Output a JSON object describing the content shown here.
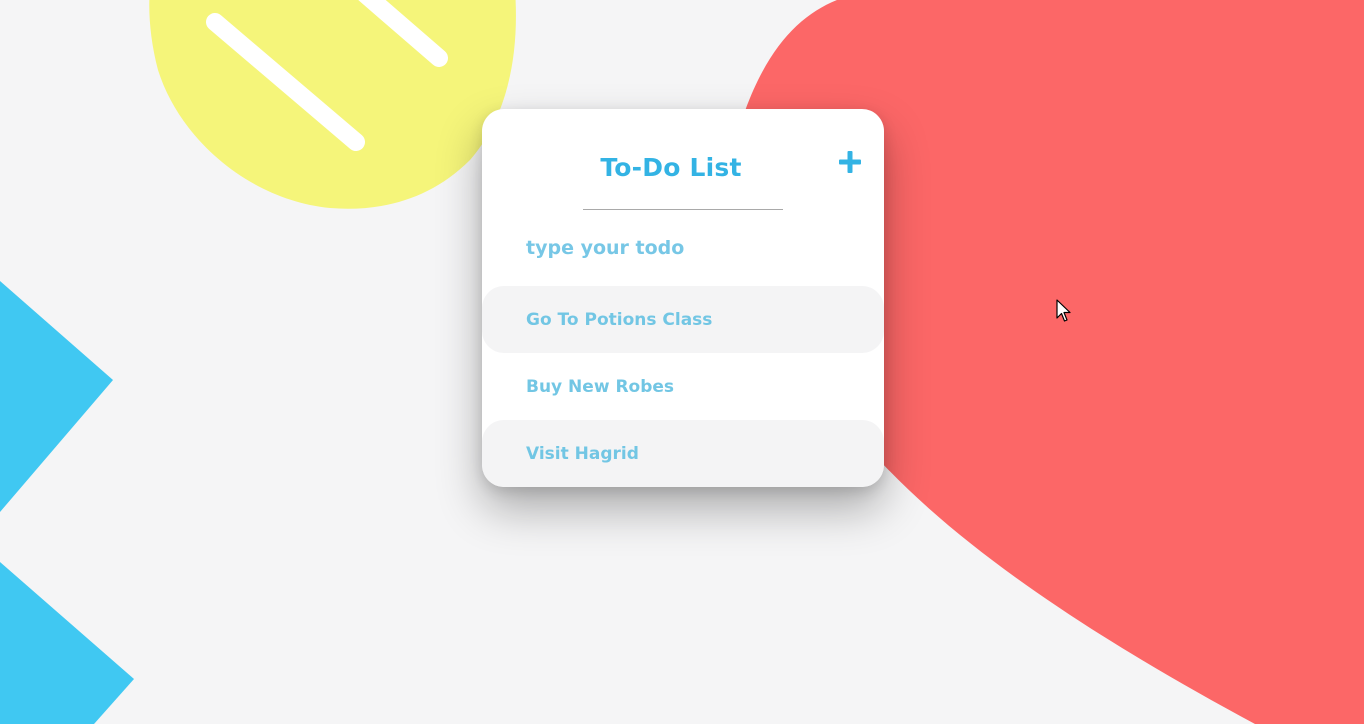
{
  "app": {
    "title": "To-Do List",
    "add_button_label": "+"
  },
  "input": {
    "placeholder": "type your todo",
    "value": ""
  },
  "todos": [
    {
      "label": "Go To Potions Class"
    },
    {
      "label": "Buy New Robes"
    },
    {
      "label": "Visit Hagrid"
    }
  ],
  "icons": {
    "add": "plus-icon",
    "cursor": "mouse-pointer-icon"
  },
  "colors": {
    "background": "#f5f5f6",
    "accent_blue": "#33b3e4",
    "item_text": "#72c6e4",
    "yellow_blob": "#f5f57a",
    "red_blob": "#fc6767",
    "cyan_shape": "#40c8f2",
    "row_shade": "#f4f4f5"
  }
}
